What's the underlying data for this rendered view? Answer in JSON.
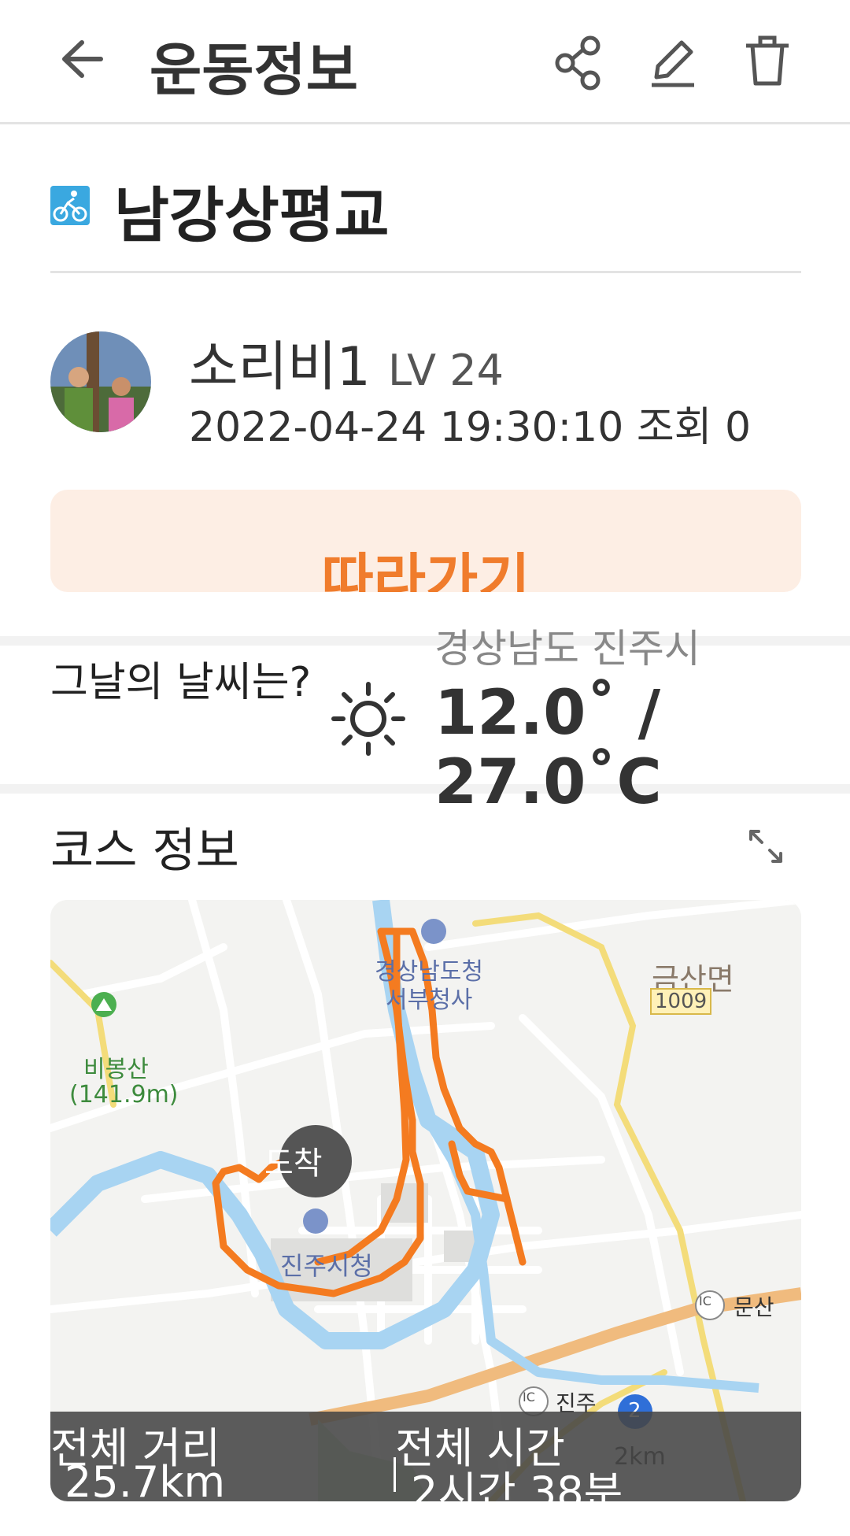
{
  "header": {
    "title": "운동정보"
  },
  "exercise": {
    "title": "남강상평교",
    "type_icon": "cycling-icon"
  },
  "profile": {
    "username": "소리비1",
    "level": "LV 24",
    "datetime": "2022-04-24 19:30:10",
    "views": "조회 0"
  },
  "follow_button": {
    "label": "따라가기"
  },
  "weather": {
    "label": "그날의 날씨는?",
    "region": "경상남도 진주시",
    "temperature_low": "12.0˚ /",
    "temperature_high": "27.0˚C",
    "icon": "sun-icon"
  },
  "course": {
    "title": "코스 정보",
    "map": {
      "labels": {
        "office": "경상남도청",
        "office2": "서부청사",
        "geumsan": "금산면",
        "road": "1009",
        "mountain": "비봉산",
        "mountain_height": "(141.9m)",
        "city_hall": "진주시청",
        "arrive": "도착",
        "munsan": "문산",
        "jinju": "진주",
        "ic": "IC",
        "badge": "2",
        "scale": "2km"
      },
      "route_color": "#f47b20",
      "river_color": "#a8d4f2"
    },
    "stats": {
      "distance_label": "전체 거리",
      "distance_value": "25.7km",
      "time_label": "전체 시간",
      "time_value": "2시간 38분"
    }
  },
  "colors": {
    "accent": "#f07c2c",
    "follow_bg": "#fdeee4"
  }
}
